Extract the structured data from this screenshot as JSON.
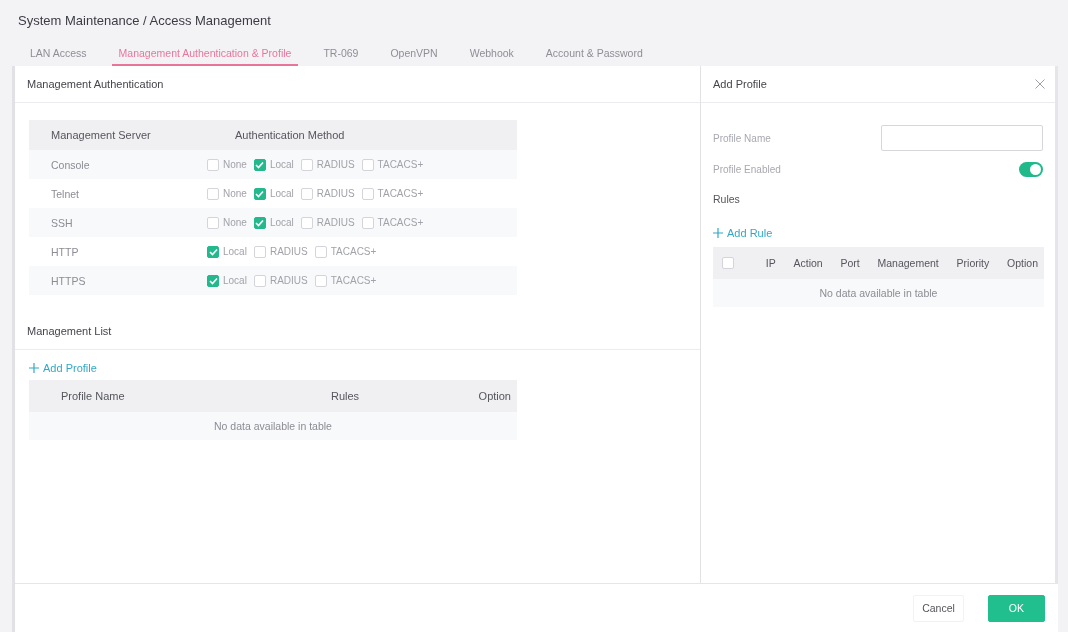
{
  "breadcrumb": "System Maintenance / Access Management",
  "tabs": [
    {
      "label": "LAN Access",
      "selected": false
    },
    {
      "label": "Management Authentication & Profile",
      "selected": true
    },
    {
      "label": "TR-069",
      "selected": false
    },
    {
      "label": "OpenVPN",
      "selected": false
    },
    {
      "label": "Webhook",
      "selected": false
    },
    {
      "label": "Account & Password",
      "selected": false
    }
  ],
  "management_authentication": {
    "title": "Management Authentication",
    "columns": [
      "Management Server",
      "Authentication Method"
    ],
    "rows": [
      {
        "server": "Console",
        "methods": [
          {
            "label": "None",
            "checked": false
          },
          {
            "label": "Local",
            "checked": true
          },
          {
            "label": "RADIUS",
            "checked": false
          },
          {
            "label": "TACACS+",
            "checked": false
          }
        ]
      },
      {
        "server": "Telnet",
        "methods": [
          {
            "label": "None",
            "checked": false
          },
          {
            "label": "Local",
            "checked": true
          },
          {
            "label": "RADIUS",
            "checked": false
          },
          {
            "label": "TACACS+",
            "checked": false
          }
        ]
      },
      {
        "server": "SSH",
        "methods": [
          {
            "label": "None",
            "checked": false
          },
          {
            "label": "Local",
            "checked": true
          },
          {
            "label": "RADIUS",
            "checked": false
          },
          {
            "label": "TACACS+",
            "checked": false
          }
        ]
      },
      {
        "server": "HTTP",
        "methods": [
          {
            "label": "Local",
            "checked": true
          },
          {
            "label": "RADIUS",
            "checked": false
          },
          {
            "label": "TACACS+",
            "checked": false
          }
        ]
      },
      {
        "server": "HTTPS",
        "methods": [
          {
            "label": "Local",
            "checked": true
          },
          {
            "label": "RADIUS",
            "checked": false
          },
          {
            "label": "TACACS+",
            "checked": false
          }
        ]
      }
    ]
  },
  "management_list": {
    "title": "Management List",
    "add_label": "Add Profile",
    "columns": [
      "Profile Name",
      "Rules",
      "Option"
    ],
    "empty_message": "No data available in table"
  },
  "add_profile": {
    "title": "Add Profile",
    "fields": [
      {
        "kind": "input",
        "label": "Profile Name"
      },
      {
        "kind": "toggle",
        "label": "Profile Enabled",
        "on": true
      }
    ],
    "rules": {
      "title": "Rules",
      "add_label": "Add Rule",
      "select_all_checked": false,
      "columns": [
        "IP",
        "Action",
        "Port",
        "Management",
        "Priority",
        "Option"
      ],
      "empty_message": "No data available in table"
    }
  },
  "buttons": [
    {
      "label": "Cancel",
      "kind": "secondary"
    },
    {
      "label": "OK",
      "kind": "primary"
    }
  ]
}
